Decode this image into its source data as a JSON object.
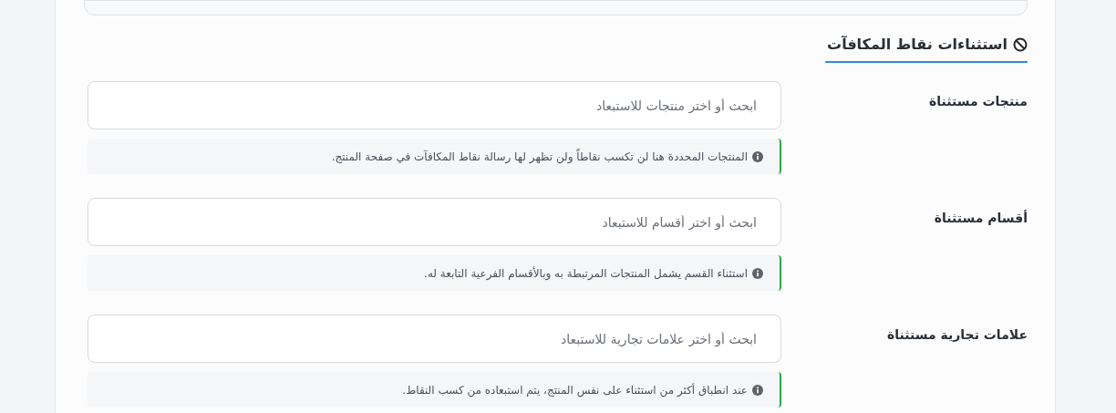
{
  "section": {
    "title": "استثناءات نقاط المكافآت"
  },
  "fields": [
    {
      "label": "منتجات مستثناة",
      "placeholder": "ابحث أو اختر منتجات للاستبعاد",
      "hint": "المنتجات المحددة هنا لن تكسب نقاطاً ولن تظهر لها رسالة نقاط المكافآت في صفحة المنتج."
    },
    {
      "label": "أقسام مستثناة",
      "placeholder": "ابحث أو اختر أقسام للاستبعاد",
      "hint": "استثناء القسم يشمل المنتجات المرتبطة به وبالأقسام الفرعية التابعة له."
    },
    {
      "label": "علامات تجارية مستثناة",
      "placeholder": "ابحث أو اختر علامات تجارية للاستبعاد",
      "hint": "عند انطباق أكثر من استثناء على نفس المنتج، يتم استبعاده من كسب النقاط."
    }
  ]
}
